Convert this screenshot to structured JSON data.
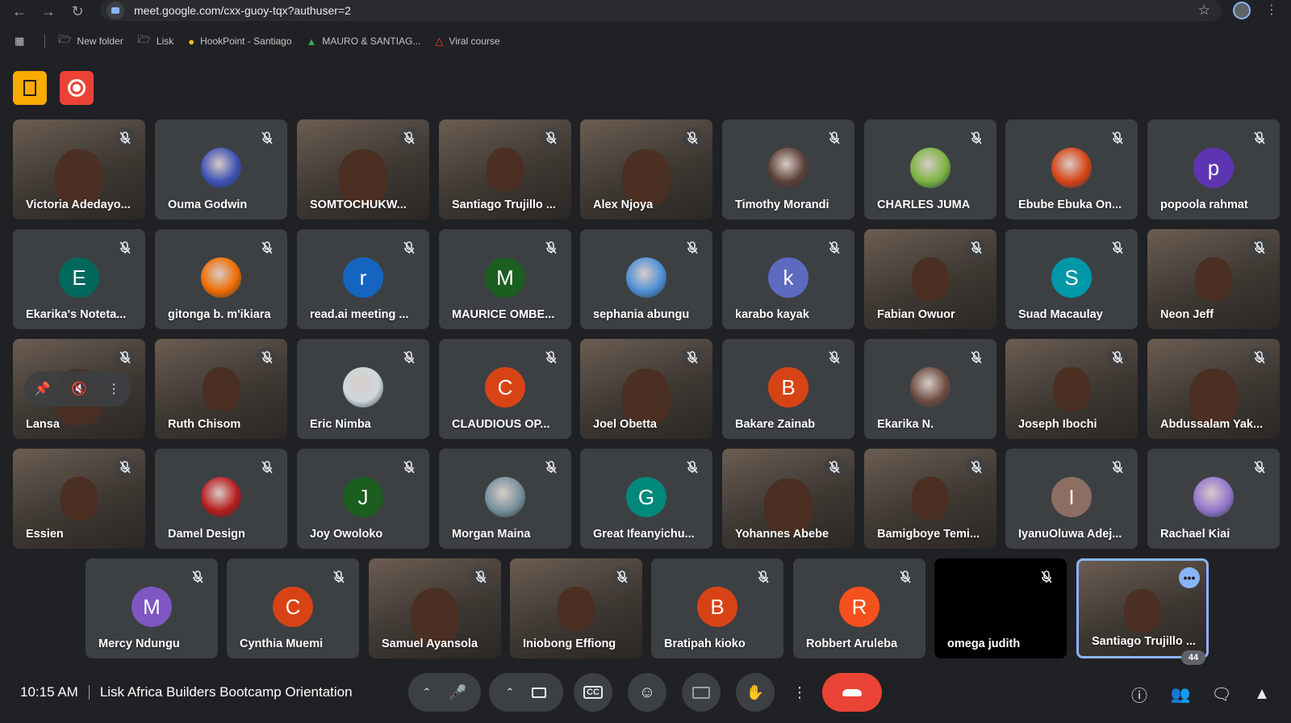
{
  "browser": {
    "url": "meet.google.com/cxx-guoy-tqx?authuser=2",
    "bookmarks": [
      {
        "label": "New folder",
        "icon": "folder-icon"
      },
      {
        "label": "Lisk",
        "icon": "folder-icon"
      },
      {
        "label": "HookPoint - Santiago",
        "icon": "lightbulb-icon"
      },
      {
        "label": "MAURO & SANTIAG...",
        "icon": "drive-icon"
      },
      {
        "label": "Viral course",
        "icon": "triangle-icon"
      }
    ]
  },
  "meeting": {
    "time": "10:15 AM",
    "title": "Lisk Africa Builders Bootcamp Orientation",
    "participant_count": "44"
  },
  "participants": [
    {
      "name": "Victoria Adedayo...",
      "type": "video"
    },
    {
      "name": "Ouma Godwin",
      "type": "photo",
      "color": "#3f51b5"
    },
    {
      "name": "SOMTOCHUKW...",
      "type": "video"
    },
    {
      "name": "Santiago Trujillo ...",
      "type": "video"
    },
    {
      "name": "Alex Njoya",
      "type": "video"
    },
    {
      "name": "Timothy Morandi",
      "type": "photo",
      "color": "#5d4037"
    },
    {
      "name": "CHARLES JUMA",
      "type": "photo",
      "color": "#7cb342"
    },
    {
      "name": "Ebube Ebuka On...",
      "type": "photo",
      "color": "#d84315"
    },
    {
      "name": "popoola rahmat",
      "type": "initial",
      "initial": "p",
      "color": "#5e35b1"
    },
    {
      "name": "Ekarika's Noteta...",
      "type": "initial",
      "initial": "E",
      "color": "#00695c"
    },
    {
      "name": "gitonga b. m'ikiara",
      "type": "photo",
      "color": "#ef6c00"
    },
    {
      "name": "read.ai meeting ...",
      "type": "initial",
      "initial": "r",
      "color": "#1565c0"
    },
    {
      "name": "MAURICE OMBE...",
      "type": "initial",
      "initial": "M",
      "color": "#1b5e20"
    },
    {
      "name": "sephania abungu",
      "type": "photo",
      "color": "#4e8fd6"
    },
    {
      "name": "karabo kayak",
      "type": "initial",
      "initial": "k",
      "color": "#5c6bc0"
    },
    {
      "name": "Fabian Owuor",
      "type": "video"
    },
    {
      "name": "Suad Macaulay",
      "type": "initial",
      "initial": "S",
      "color": "#0097a7"
    },
    {
      "name": "Neon Jeff",
      "type": "video"
    },
    {
      "name": "Lansa",
      "type": "video",
      "hover": true
    },
    {
      "name": "Ruth Chisom",
      "type": "video"
    },
    {
      "name": "Eric Nimba",
      "type": "photo",
      "color": "#cfd8dc"
    },
    {
      "name": "CLAUDIOUS OP...",
      "type": "initial",
      "initial": "C",
      "color": "#d84315"
    },
    {
      "name": "Joel Obetta",
      "type": "video"
    },
    {
      "name": "Bakare Zainab",
      "type": "initial",
      "initial": "B",
      "color": "#d84315"
    },
    {
      "name": "Ekarika N.",
      "type": "photo",
      "color": "#6d4c41"
    },
    {
      "name": "Joseph Ibochi",
      "type": "video"
    },
    {
      "name": "Abdussalam Yak...",
      "type": "video"
    },
    {
      "name": "Essien",
      "type": "video"
    },
    {
      "name": "Damel Design",
      "type": "photo",
      "color": "#b71c1c"
    },
    {
      "name": "Joy Owoloko",
      "type": "initial",
      "initial": "J",
      "color": "#1b5e20"
    },
    {
      "name": "Morgan Maina",
      "type": "photo",
      "color": "#78909c"
    },
    {
      "name": "Great Ifeanyichu...",
      "type": "initial",
      "initial": "G",
      "color": "#00897b"
    },
    {
      "name": "Yohannes Abebe",
      "type": "video"
    },
    {
      "name": "Bamigboye Temi...",
      "type": "video"
    },
    {
      "name": "IyanuOluwa Adej...",
      "type": "initial",
      "initial": "I",
      "color": "#8d6e63"
    },
    {
      "name": "Rachael Kiai",
      "type": "photo",
      "color": "#9575cd"
    },
    {
      "name": "Mercy Ndungu",
      "type": "initial",
      "initial": "M",
      "color": "#7e57c2"
    },
    {
      "name": "Cynthia Muemi",
      "type": "initial",
      "initial": "C",
      "color": "#d84315"
    },
    {
      "name": "Samuel Ayansola",
      "type": "video"
    },
    {
      "name": "Iniobong Effiong",
      "type": "video"
    },
    {
      "name": "Bratipah kioko",
      "type": "initial",
      "initial": "B",
      "color": "#d84315"
    },
    {
      "name": "Robbert Aruleba",
      "type": "initial",
      "initial": "R",
      "color": "#f4511e"
    },
    {
      "name": "omega judith",
      "type": "dark"
    },
    {
      "name": "Santiago Trujillo ...",
      "type": "video",
      "active": true
    }
  ]
}
